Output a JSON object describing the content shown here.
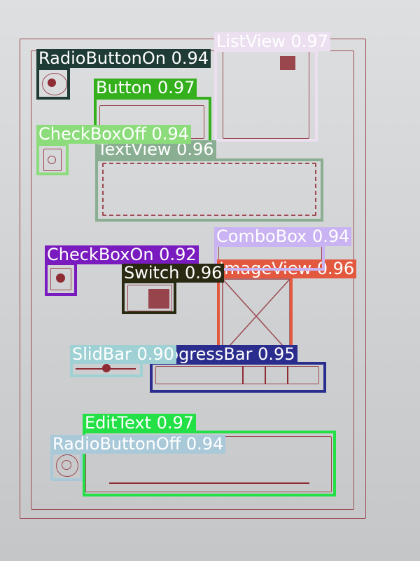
{
  "detections": {
    "radio_on": {
      "label": "RadioButtonOn 0.94",
      "color": "#1e3b35",
      "text_color": "#ffffff"
    },
    "list_view": {
      "label": "ListView 0.97",
      "color": "#ebdff0",
      "text_color": "#ffffff"
    },
    "button": {
      "label": "Button 0.97",
      "color": "#33b01c",
      "text_color": "#ffffff"
    },
    "check_off": {
      "label": "CheckBoxOff 0.94",
      "color": "#8cdc7c",
      "text_color": "#ffffff"
    },
    "text_view": {
      "label": "TextView 0.96",
      "color": "#8aae92",
      "text_color": "#ffffff"
    },
    "combo_box": {
      "label": "ComboBox 0.94",
      "color": "#c9b3f2",
      "text_color": "#ffffff"
    },
    "check_on": {
      "label": "CheckBoxOn 0.92",
      "color": "#7a1bbf",
      "text_color": "#ffffff"
    },
    "image_view": {
      "label": "ImageView 0.96",
      "color": "#e3593f",
      "text_color": "#ffffff"
    },
    "switch": {
      "label": "Switch 0.96",
      "color": "#2a2a12",
      "text_color": "#ffffff"
    },
    "progress": {
      "label": "ProgressBar 0.95",
      "color": "#2b2d8e",
      "text_color": "#ffffff"
    },
    "slid_bar": {
      "label": "SlidBar 0.90",
      "color": "#9fd1d4",
      "text_color": "#ffffff"
    },
    "edit_text": {
      "label": "EditText 0.97",
      "color": "#22e045",
      "text_color": "#ffffff"
    },
    "radio_off": {
      "label": "RadioButtonOff 0.94",
      "color": "#a9c9d9",
      "text_color": "#ffffff"
    }
  }
}
